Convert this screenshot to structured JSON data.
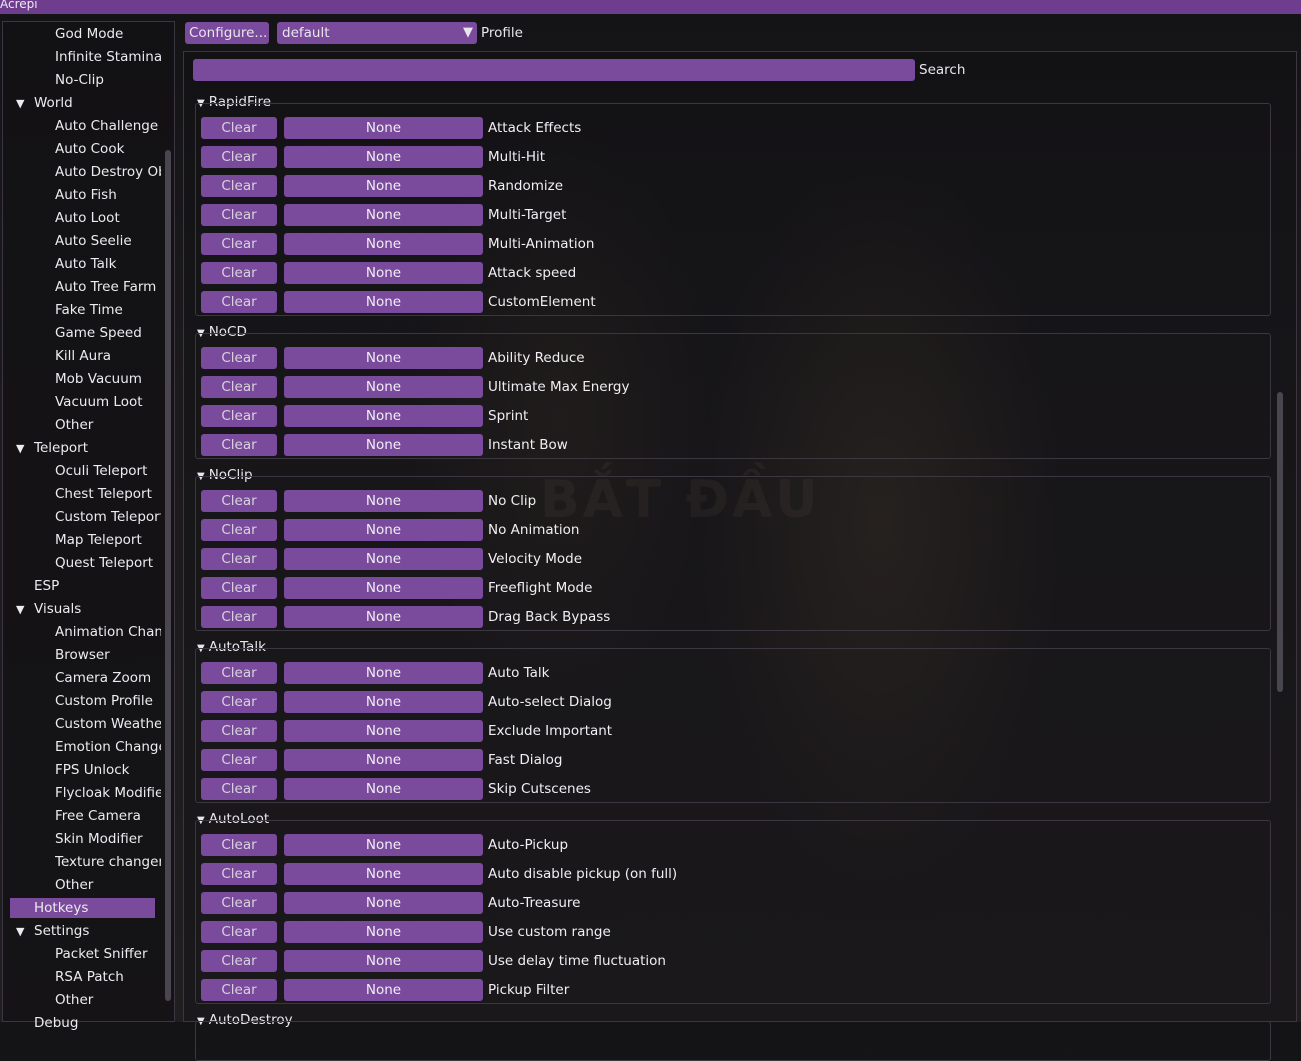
{
  "window": {
    "title": "Acrepi"
  },
  "toolbar": {
    "configure_label": "Configure...",
    "profile_value": "default",
    "profile_label": "Profile"
  },
  "search": {
    "value": "",
    "label": "Search"
  },
  "sidebar": {
    "items": [
      {
        "label": "God Mode",
        "kind": "sub"
      },
      {
        "label": "Infinite Stamina",
        "kind": "sub"
      },
      {
        "label": "No-Clip",
        "kind": "sub"
      },
      {
        "label": "World",
        "kind": "grp"
      },
      {
        "label": "Auto Challenge",
        "kind": "sub"
      },
      {
        "label": "Auto Cook",
        "kind": "sub"
      },
      {
        "label": "Auto Destroy Objects",
        "kind": "sub"
      },
      {
        "label": "Auto Fish",
        "kind": "sub"
      },
      {
        "label": "Auto Loot",
        "kind": "sub"
      },
      {
        "label": "Auto Seelie",
        "kind": "sub"
      },
      {
        "label": "Auto Talk",
        "kind": "sub"
      },
      {
        "label": "Auto Tree Farm",
        "kind": "sub"
      },
      {
        "label": "Fake Time",
        "kind": "sub"
      },
      {
        "label": "Game Speed",
        "kind": "sub"
      },
      {
        "label": "Kill Aura",
        "kind": "sub"
      },
      {
        "label": "Mob Vacuum",
        "kind": "sub"
      },
      {
        "label": "Vacuum Loot",
        "kind": "sub"
      },
      {
        "label": "Other",
        "kind": "sub"
      },
      {
        "label": "Teleport",
        "kind": "grp"
      },
      {
        "label": "Oculi Teleport",
        "kind": "sub"
      },
      {
        "label": "Chest Teleport",
        "kind": "sub"
      },
      {
        "label": "Custom Teleport",
        "kind": "sub"
      },
      {
        "label": "Map Teleport",
        "kind": "sub"
      },
      {
        "label": "Quest Teleport",
        "kind": "sub"
      },
      {
        "label": "ESP",
        "kind": "leaf"
      },
      {
        "label": "Visuals",
        "kind": "grp"
      },
      {
        "label": "Animation Changer",
        "kind": "sub"
      },
      {
        "label": "Browser",
        "kind": "sub"
      },
      {
        "label": "Camera Zoom",
        "kind": "sub"
      },
      {
        "label": "Custom Profile",
        "kind": "sub"
      },
      {
        "label": "Custom Weather",
        "kind": "sub"
      },
      {
        "label": "Emotion Changer",
        "kind": "sub"
      },
      {
        "label": "FPS Unlock",
        "kind": "sub"
      },
      {
        "label": "Flycloak Modifier",
        "kind": "sub"
      },
      {
        "label": "Free Camera",
        "kind": "sub"
      },
      {
        "label": "Skin Modifier",
        "kind": "sub"
      },
      {
        "label": "Texture changer",
        "kind": "sub"
      },
      {
        "label": "Other",
        "kind": "sub"
      },
      {
        "label": "Hotkeys",
        "kind": "active"
      },
      {
        "label": "Settings",
        "kind": "grp"
      },
      {
        "label": "Packet Sniffer",
        "kind": "sub"
      },
      {
        "label": "RSA Patch",
        "kind": "sub"
      },
      {
        "label": "Other",
        "kind": "sub"
      },
      {
        "label": "Debug",
        "kind": "leaf"
      }
    ]
  },
  "hotkeys": {
    "clear_label": "Clear",
    "none_label": "None",
    "sections": [
      {
        "title": "RapidFire",
        "rows": [
          "Attack Effects",
          "Multi-Hit",
          "Randomize",
          "Multi-Target",
          "Multi-Animation",
          "Attack speed",
          "CustomElement"
        ]
      },
      {
        "title": "NoCD",
        "rows": [
          "Ability Reduce",
          "Ultimate Max Energy",
          "Sprint",
          "Instant Bow"
        ]
      },
      {
        "title": "NoClip",
        "rows": [
          "No Clip",
          "No Animation",
          "Velocity Mode",
          "Freeflight Mode",
          "Drag Back Bypass"
        ]
      },
      {
        "title": "AutoTalk",
        "rows": [
          "Auto Talk",
          "Auto-select Dialog",
          "Exclude Important",
          "Fast Dialog",
          "Skip Cutscenes"
        ]
      },
      {
        "title": "AutoLoot",
        "rows": [
          "Auto-Pickup",
          "Auto disable pickup (on full)",
          "Auto-Treasure",
          "Use custom range",
          "Use delay time fluctuation",
          "Pickup Filter"
        ]
      },
      {
        "title": "AutoDestroy",
        "rows": []
      }
    ]
  },
  "background_text": "BẮT ĐẦU",
  "colors": {
    "accent": "#7a4a9c",
    "titlebar": "#6e3d8e",
    "border": "#3b3640"
  }
}
